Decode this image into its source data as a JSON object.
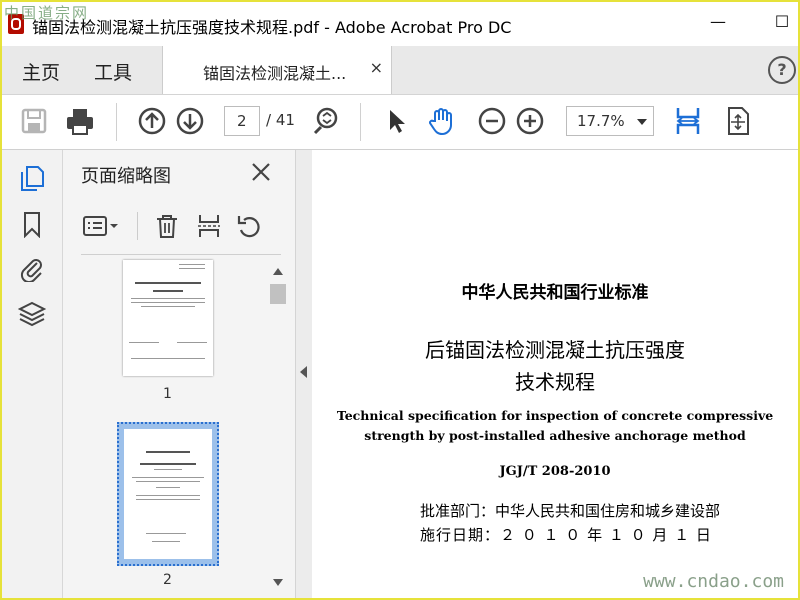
{
  "window": {
    "title": "锚固法检测混凝土抗压强度技术规程.pdf - Adobe Acrobat Pro DC",
    "watermark_top": "中国道宗网",
    "minimize": "—",
    "maximize": "☐"
  },
  "menu": {
    "home": "主页",
    "tools": "工具"
  },
  "tab": {
    "label": "锚固法检测混凝土...",
    "close": "×"
  },
  "help": "?",
  "toolbar": {
    "current_page": "2",
    "total_pages": "/ 41",
    "zoom": "17.7%"
  },
  "thumbnails_panel": {
    "title": "页面缩略图",
    "pages": [
      {
        "number": "1"
      },
      {
        "number": "2"
      }
    ]
  },
  "document": {
    "line1": "中华人民共和国行业标准",
    "line2": "后锚固法检测混凝土抗压强度",
    "line3": "技术规程",
    "line4": "Technical specification for inspection of concrete compressive",
    "line5": "strength by post-installed adhesive anchorage method",
    "line6": "JGJ/T 208-2010",
    "line7": "批准部门：中华人民共和国住房和城乡建设部",
    "line8": "施行日期：２ ０ １ ０ 年 １ ０ 月 １ 日"
  },
  "watermark_bottom": "www.cndao.com",
  "colors": {
    "accent_blue": "#1d6fd6",
    "border_yellow": "#e6e23a",
    "acrobat_red": "#b30b00"
  }
}
